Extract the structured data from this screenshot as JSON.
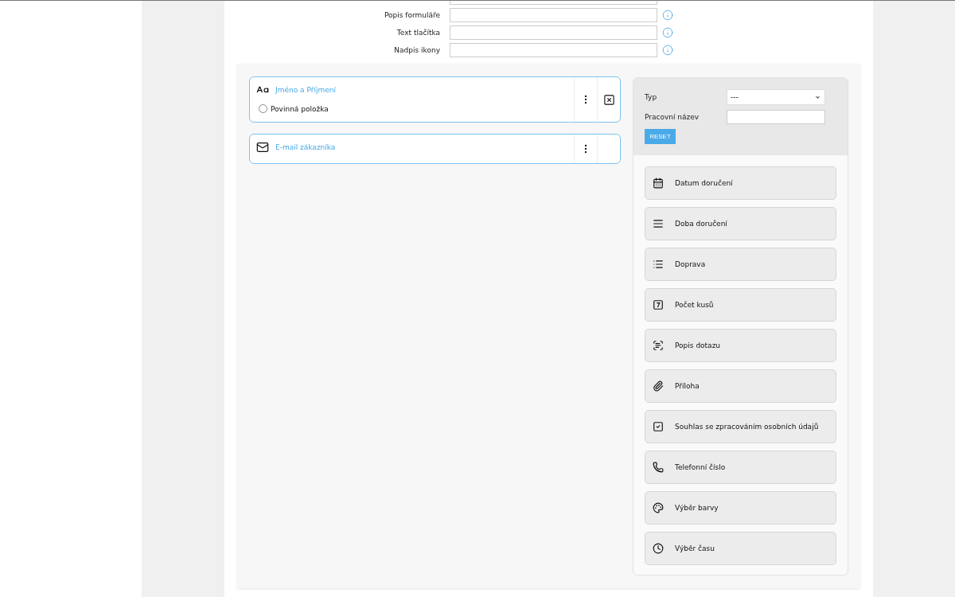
{
  "settings": [
    {
      "label": "Popis formuláře"
    },
    {
      "label": "Text tlačítka"
    },
    {
      "label": "Nadpis ikony"
    }
  ],
  "form_fields": [
    {
      "kind": "text",
      "label": "Jméno a Příjmení",
      "required_label": "Povinná položka",
      "required": false,
      "deletable": true
    },
    {
      "kind": "email",
      "label": "E-mail zákazníka",
      "deletable": false
    }
  ],
  "filter": {
    "type_label": "Typ",
    "type_value": "---",
    "name_label": "Pracovní název",
    "reset": "RESET"
  },
  "palette": [
    {
      "kind": "date",
      "label": "Datum doručení"
    },
    {
      "kind": "lines",
      "label": "Doba doručení"
    },
    {
      "kind": "list",
      "label": "Doprava"
    },
    {
      "kind": "number",
      "label": "Počet kusů"
    },
    {
      "kind": "textarea",
      "label": "Popis dotazu"
    },
    {
      "kind": "file",
      "label": "Příloha"
    },
    {
      "kind": "checkbox",
      "label": "Souhlas se zpracováním osobních údajů"
    },
    {
      "kind": "phone",
      "label": "Telefonní číslo"
    },
    {
      "kind": "color",
      "label": "Výběr barvy"
    },
    {
      "kind": "time",
      "label": "Výběr času"
    }
  ]
}
